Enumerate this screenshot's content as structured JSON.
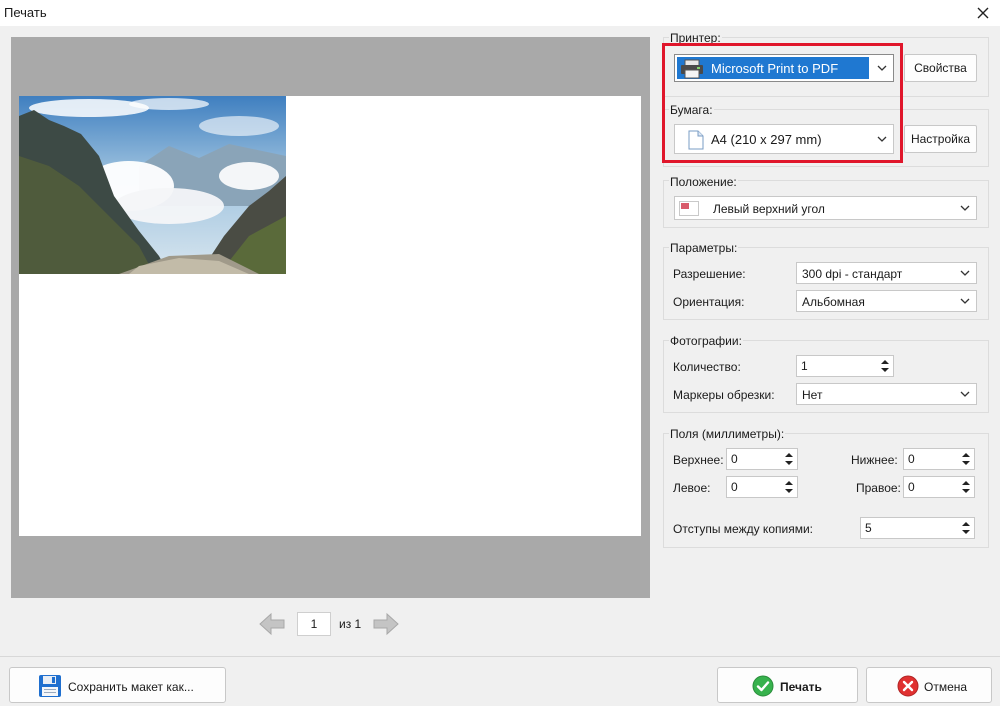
{
  "window": {
    "title": "Печать",
    "close_icon": "close-icon"
  },
  "preview": {
    "page_current": "1",
    "page_of_label": "из 1",
    "prev_icon": "arrow-left-icon",
    "next_icon": "arrow-right-icon"
  },
  "printer": {
    "group_label": "Принтер:",
    "selected": "Microsoft Print to PDF",
    "properties_button": "Свойства"
  },
  "paper": {
    "group_label": "Бумага:",
    "selected": "A4 (210 x 297 mm)",
    "settings_button": "Настройка"
  },
  "position": {
    "group_label": "Положение:",
    "selected": "Левый верхний угол"
  },
  "parameters": {
    "group_label": "Параметры:",
    "resolution_label": "Разрешение:",
    "resolution_value": "300 dpi - стандарт",
    "orientation_label": "Ориентация:",
    "orientation_value": "Альбомная"
  },
  "photos": {
    "group_label": "Фотографии:",
    "quantity_label": "Количество:",
    "quantity_value": "1",
    "crop_marks_label": "Маркеры обрезки:",
    "crop_marks_value": "Нет"
  },
  "margins": {
    "group_label": "Поля (миллиметры):",
    "top_label": "Верхнее:",
    "top_value": "0",
    "bottom_label": "Нижнее:",
    "bottom_value": "0",
    "left_label": "Левое:",
    "left_value": "0",
    "right_label": "Правое:",
    "right_value": "0",
    "copies_gap_label": "Отступы между копиями:",
    "copies_gap_value": "5"
  },
  "footer": {
    "save_layout_button": "Сохранить макет как...",
    "print_button": "Печать",
    "cancel_button": "Отмена"
  },
  "colors": {
    "highlight": "#e0162b",
    "selection": "#1f78d1",
    "preview_bg": "#a9a9a9"
  }
}
